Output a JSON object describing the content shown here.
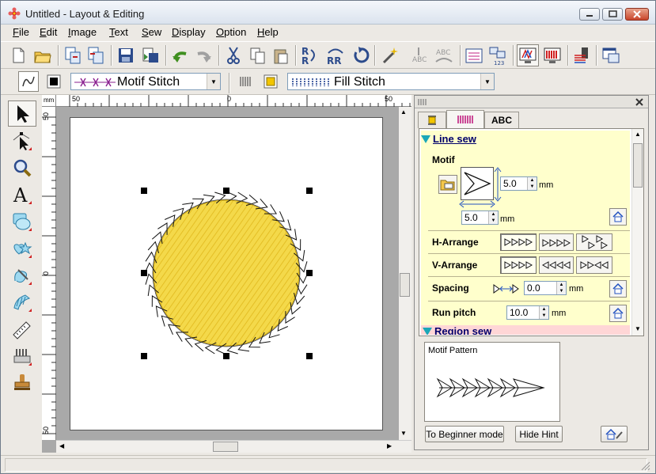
{
  "window": {
    "title": "Untitled - Layout & Editing"
  },
  "menu": [
    "File",
    "Edit",
    "Image",
    "Text",
    "Sew",
    "Display",
    "Option",
    "Help"
  ],
  "toolbar2": {
    "line_stitch": "Motif Stitch",
    "region_stitch": "Fill Stitch"
  },
  "rulers": {
    "h_ticks": [
      "50",
      "0",
      "50"
    ],
    "v_ticks": [
      "50",
      "0",
      "50"
    ],
    "unit": "mm"
  },
  "panel": {
    "tabs": [
      "",
      "",
      "ABC"
    ],
    "line_sew": {
      "header": "Line sew",
      "motif_label": "Motif",
      "height": "5.0",
      "width": "5.0",
      "unit": "mm",
      "h_arrange": "H-Arrange",
      "v_arrange": "V-Arrange",
      "spacing_label": "Spacing",
      "spacing": "0.0",
      "run_pitch_label": "Run pitch",
      "run_pitch": "10.0"
    },
    "region_sew": {
      "header": "Region sew"
    },
    "preview_label": "Motif Pattern",
    "beginner_button": "To Beginner mode",
    "hide_hint_button": "Hide Hint"
  },
  "colors": {
    "fill": "#f4d94a",
    "region_header_bg": "#ffd6d6",
    "panel_bg": "#ffffcc"
  }
}
